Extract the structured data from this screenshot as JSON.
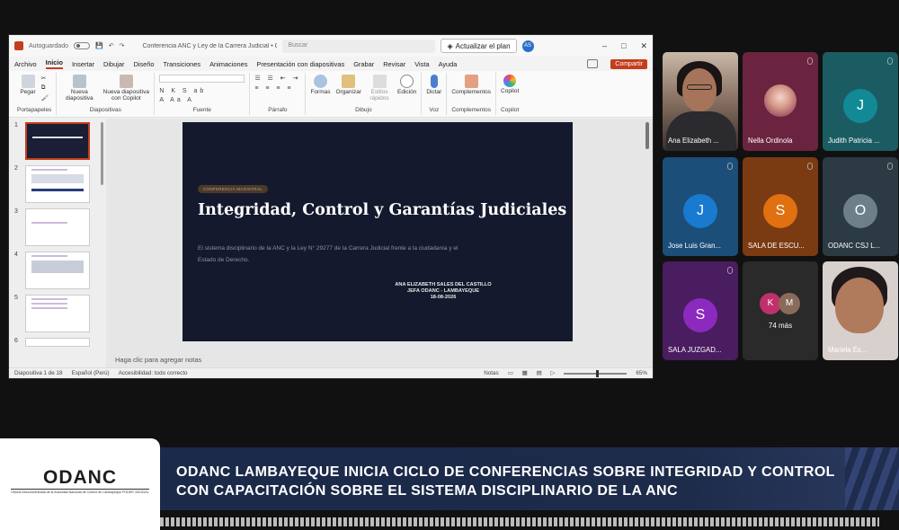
{
  "powerpoint": {
    "autosave_label": "Autoguardado",
    "doc_title": "Conferencia ANC y Ley de la Carrera Judicial • Guardado",
    "search_placeholder": "Buscar",
    "upgrade_label": "Actualizar el plan",
    "user_initials": "AS",
    "window_controls": [
      "–",
      "□",
      "✕"
    ],
    "menu_tabs": [
      "Archivo",
      "Inicio",
      "Insertar",
      "Dibujar",
      "Diseño",
      "Transiciones",
      "Animaciones",
      "Presentación con diapositivas",
      "Grabar",
      "Revisar",
      "Vista",
      "Ayuda"
    ],
    "active_tab": "Inicio",
    "share_label": "Compartir",
    "ribbon": {
      "paste": "Pegar",
      "new_slide": "Nueva diapositiva",
      "new_slide_copilot": "Nueva diapositiva con Copilot",
      "shapes": "Formas",
      "arrange": "Organizar",
      "quick_styles": "Estilos rápidos",
      "editing": "Edición",
      "dictate": "Dictar",
      "addins": "Complementos",
      "copilot": "Copilot",
      "groups": [
        "Portapapeles",
        "Diapositivas",
        "Fuente",
        "Párrafo",
        "Dibujo",
        "Voz",
        "Complementos",
        "Copilot"
      ]
    },
    "slide_numbers": [
      "1",
      "2",
      "3",
      "4",
      "5",
      "6"
    ],
    "slide": {
      "badge": "CONFERENCIA MAGISTRAL",
      "title": "Integridad, Control y Garantías Judiciales",
      "description": "El sistema disciplinario de la ANC y la Ley N° 29277 de la Carrera Judicial frente a la ciudadanía y el Estado de Derecho.",
      "author_line1": "ANA ELIZABETH SALES DEL CASTILLO",
      "author_line2": "JEFA ODANC - LAMBAYEQUE",
      "author_line3": "18-08-2026"
    },
    "notes_placeholder": "Haga clic para agregar notas",
    "status": {
      "slide_count": "Diapositiva 1 de 18",
      "language": "Español (Perú)",
      "accessibility": "Accesibilidad: todo correcto",
      "notes": "Notas",
      "zoom": "65%"
    }
  },
  "participants": [
    {
      "name": "Ana Elizabeth ...",
      "type": "video",
      "color": "#3a2e2a"
    },
    {
      "name": "Nella Ordinola",
      "type": "photo",
      "color": "#6a2440"
    },
    {
      "name": "Judith Patricia ...",
      "initial": "J",
      "color": "#1b5c62",
      "avatar_color": "#128a96"
    },
    {
      "name": "Jose Luis Gran...",
      "initial": "J",
      "color": "#1b4e78",
      "avatar_color": "#1a7ad0"
    },
    {
      "name": "SALA DE ESCU...",
      "initial": "S",
      "color": "#7a3a12",
      "avatar_color": "#e07010"
    },
    {
      "name": "ODANC CSJ L...",
      "initial": "O",
      "color": "#2c3a44",
      "avatar_color": "#6e7f89"
    },
    {
      "name": "SALA JUZGAD...",
      "initial": "S",
      "color": "#4a1c60",
      "avatar_color": "#8c2ac0"
    },
    {
      "name": "74 más",
      "initials": [
        "K",
        "M"
      ],
      "color": "#2a2a2a"
    },
    {
      "name": "Mariela Es...",
      "type": "video",
      "color": "#d8d0cc"
    }
  ],
  "banner": {
    "logo": "ODANC",
    "logo_subtitle": "Oficina Desconcentrada de la Autoridad Nacional de Control de Lambayeque PODER JUDICIAL",
    "headline": "ODANC LAMBAYEQUE INICIA CICLO DE CONFERENCIAS SOBRE INTEGRIDAD Y CONTROL CON CAPACITACIÓN SOBRE EL SISTEMA DISCIPLINARIO DE LA ANC"
  }
}
